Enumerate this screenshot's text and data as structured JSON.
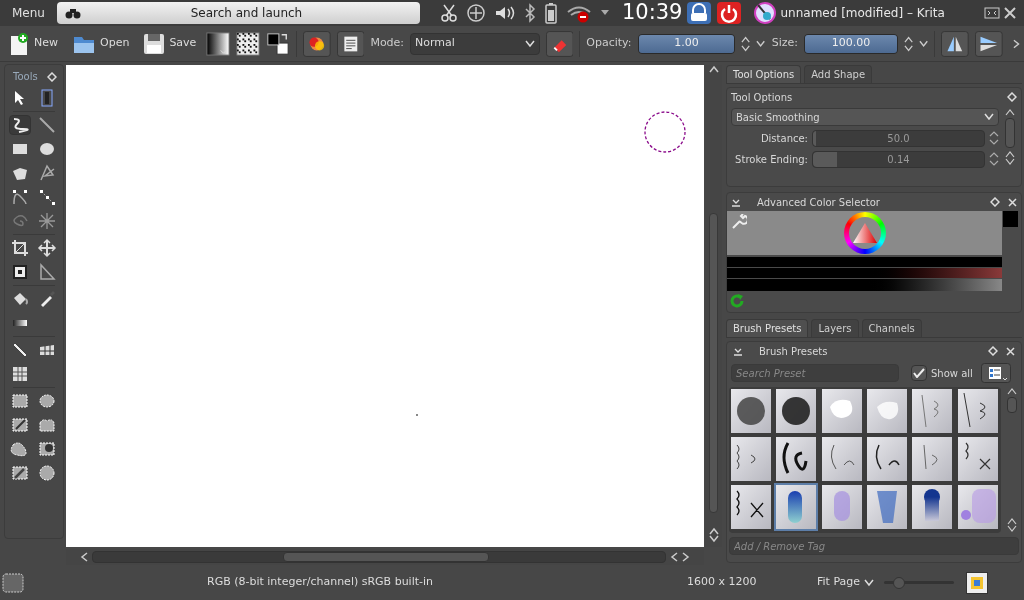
{
  "top_panel": {
    "menu": "Menu",
    "search": "Search and launch",
    "clock": "10:39",
    "window_title": "unnamed [modified] – Krita"
  },
  "toolbar": {
    "new": "New",
    "open": "Open",
    "save": "Save",
    "mode_label": "Mode:",
    "mode": "Normal",
    "opacity_label": "Opacity:",
    "opacity": {
      "reading": "1.00",
      "level": 1
    },
    "size_label": "Size:",
    "size": {
      "reading": "100.00",
      "level": 1
    }
  },
  "toolbox": {
    "title": "Tools",
    "groups": [
      [
        {
          "selected": false
        },
        {
          "selected": false
        }
      ],
      [
        {
          "selected": true
        },
        {
          "selected": false
        },
        {
          "selected": false
        },
        {
          "selected": false
        },
        {
          "selected": false
        },
        {
          "selected": false
        },
        {
          "selected": false
        },
        {
          "selected": false
        },
        {
          "selected": false
        },
        {
          "selected": false
        }
      ],
      [
        {
          "selected": false
        },
        {
          "selected": false
        },
        {
          "selected": false
        },
        {
          "selected": false
        }
      ],
      [
        {
          "selected": false
        },
        {
          "selected": false
        },
        {
          "selected": false
        }
      ],
      [
        {
          "selected": false
        },
        {
          "selected": false
        },
        {
          "selected": false
        }
      ],
      [
        {
          "selected": false
        },
        {
          "selected": false
        },
        {
          "selected": false
        },
        {
          "selected": false
        },
        {
          "selected": false
        },
        {
          "selected": false
        },
        {
          "selected": false
        },
        {
          "selected": false
        }
      ]
    ]
  },
  "dock_tabs_top": [
    {
      "label": "Tool Options",
      "selected": true
    },
    {
      "label": "Add Shape",
      "selected": false
    }
  ],
  "tool_options": {
    "title": "Tool Options",
    "smoothing": "Basic Smoothing",
    "rows": [
      {
        "label": "Distance:",
        "reading": "50.0",
        "level": 0.02
      },
      {
        "label": "Stroke Ending:",
        "reading": "0.14",
        "level": 0.14
      }
    ]
  },
  "color_selector": {
    "title": "Advanced Color Selector"
  },
  "dock_tabs_bottom": [
    {
      "label": "Brush Presets",
      "selected": true
    },
    {
      "label": "Layers",
      "selected": false
    },
    {
      "label": "Channels",
      "selected": false
    }
  ],
  "brush_presets": {
    "title": "Brush Presets",
    "search_placeholder": "Search Preset",
    "show_all": {
      "label": "Show all",
      "checked": true
    },
    "tag_placeholder": "Add / Remove Tag",
    "presets": [
      {
        "selected": false
      },
      {
        "selected": false
      },
      {
        "selected": false
      },
      {
        "selected": false
      },
      {
        "selected": false
      },
      {
        "selected": false
      },
      {
        "selected": false
      },
      {
        "selected": false
      },
      {
        "selected": false
      },
      {
        "selected": false
      },
      {
        "selected": false
      },
      {
        "selected": false
      },
      {
        "selected": false
      },
      {
        "selected": true
      },
      {
        "selected": false
      },
      {
        "selected": false
      },
      {
        "selected": false
      },
      {
        "selected": false
      }
    ]
  },
  "status_bar": {
    "color_space": "RGB (8-bit integer/channel)  sRGB built-in",
    "dimensions": "1600 x 1200",
    "zoom": "Fit Page",
    "zoom_slider": {
      "level": 0.15
    }
  }
}
